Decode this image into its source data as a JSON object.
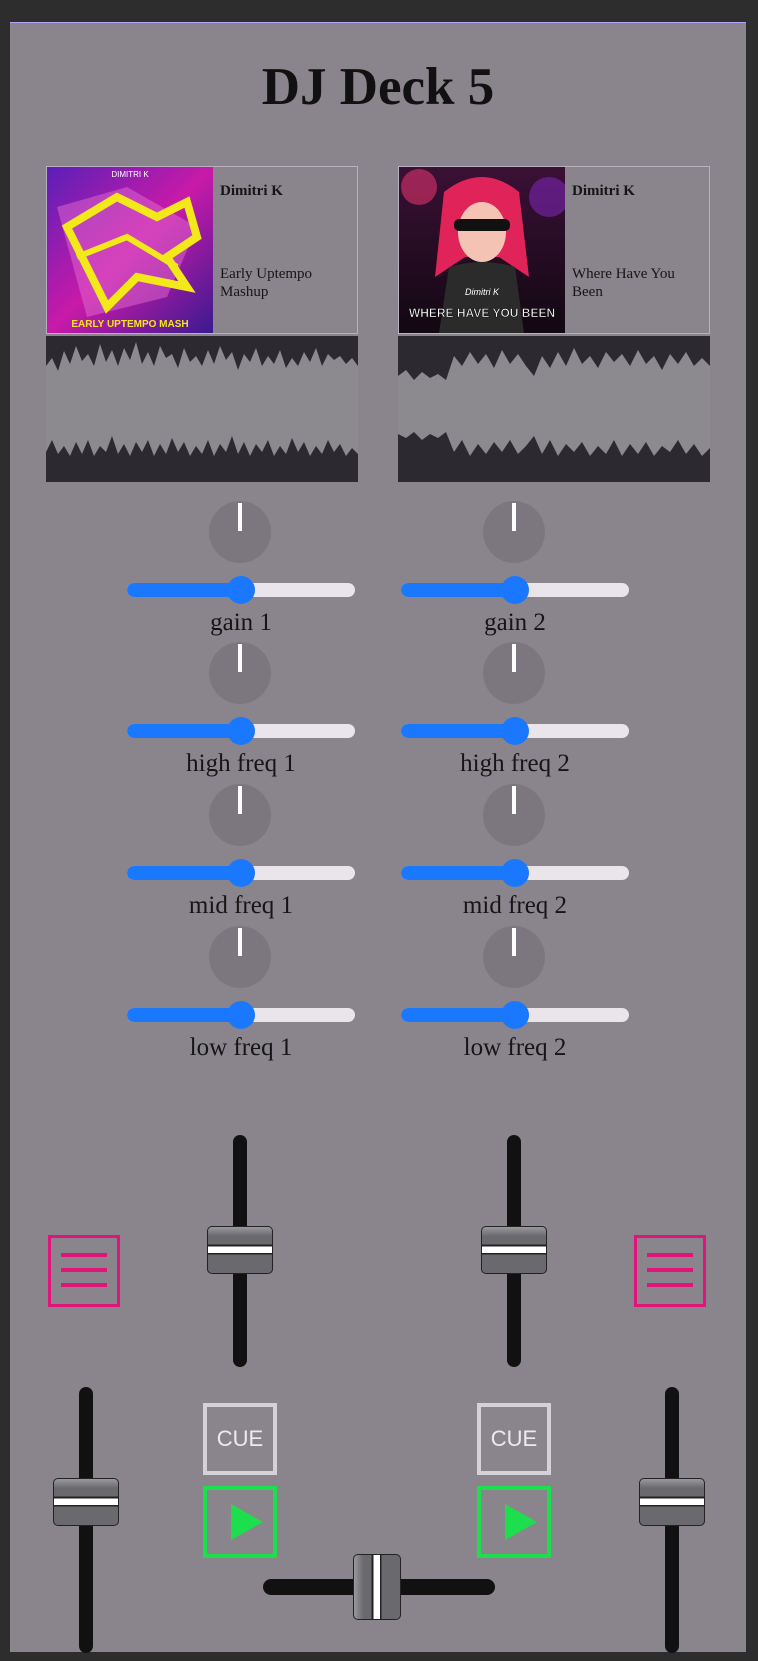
{
  "title": "DJ Deck 5",
  "colors": {
    "panel": "#8a858c",
    "accent_blue": "#1a78ff",
    "menu_pink": "#e0147a",
    "play_green": "#1dde4c",
    "waveform_bg": "#2c2a30"
  },
  "decks": [
    {
      "artist": "Dimitri K",
      "song": "Early Uptempo Mashup",
      "art_text": "EARLY UPTEMPO MASH",
      "art_top_text": "DIMITRI K",
      "knobs": [
        {
          "label": "gain 1",
          "value": 0.5
        },
        {
          "label": "high freq 1",
          "value": 0.5
        },
        {
          "label": "mid freq 1",
          "value": 0.5
        },
        {
          "label": "low freq 1",
          "value": 0.5
        }
      ],
      "volume_fader": 0.5,
      "pitch_fader": 0.5,
      "cue_label": "CUE"
    },
    {
      "artist": "Dimitri K",
      "song": "Where Have You Been",
      "art_text": "WHERE HAVE YOU BEEN",
      "art_top_text": "Dimitri K",
      "knobs": [
        {
          "label": "gain 2",
          "value": 0.5
        },
        {
          "label": "high freq 2",
          "value": 0.5
        },
        {
          "label": "mid freq 2",
          "value": 0.5
        },
        {
          "label": "low freq 2",
          "value": 0.5
        }
      ],
      "volume_fader": 0.5,
      "pitch_fader": 0.5,
      "cue_label": "CUE"
    }
  ],
  "crossfader": 0.5,
  "icons": {
    "menu": "hamburger-menu-icon",
    "play": "play-icon"
  }
}
